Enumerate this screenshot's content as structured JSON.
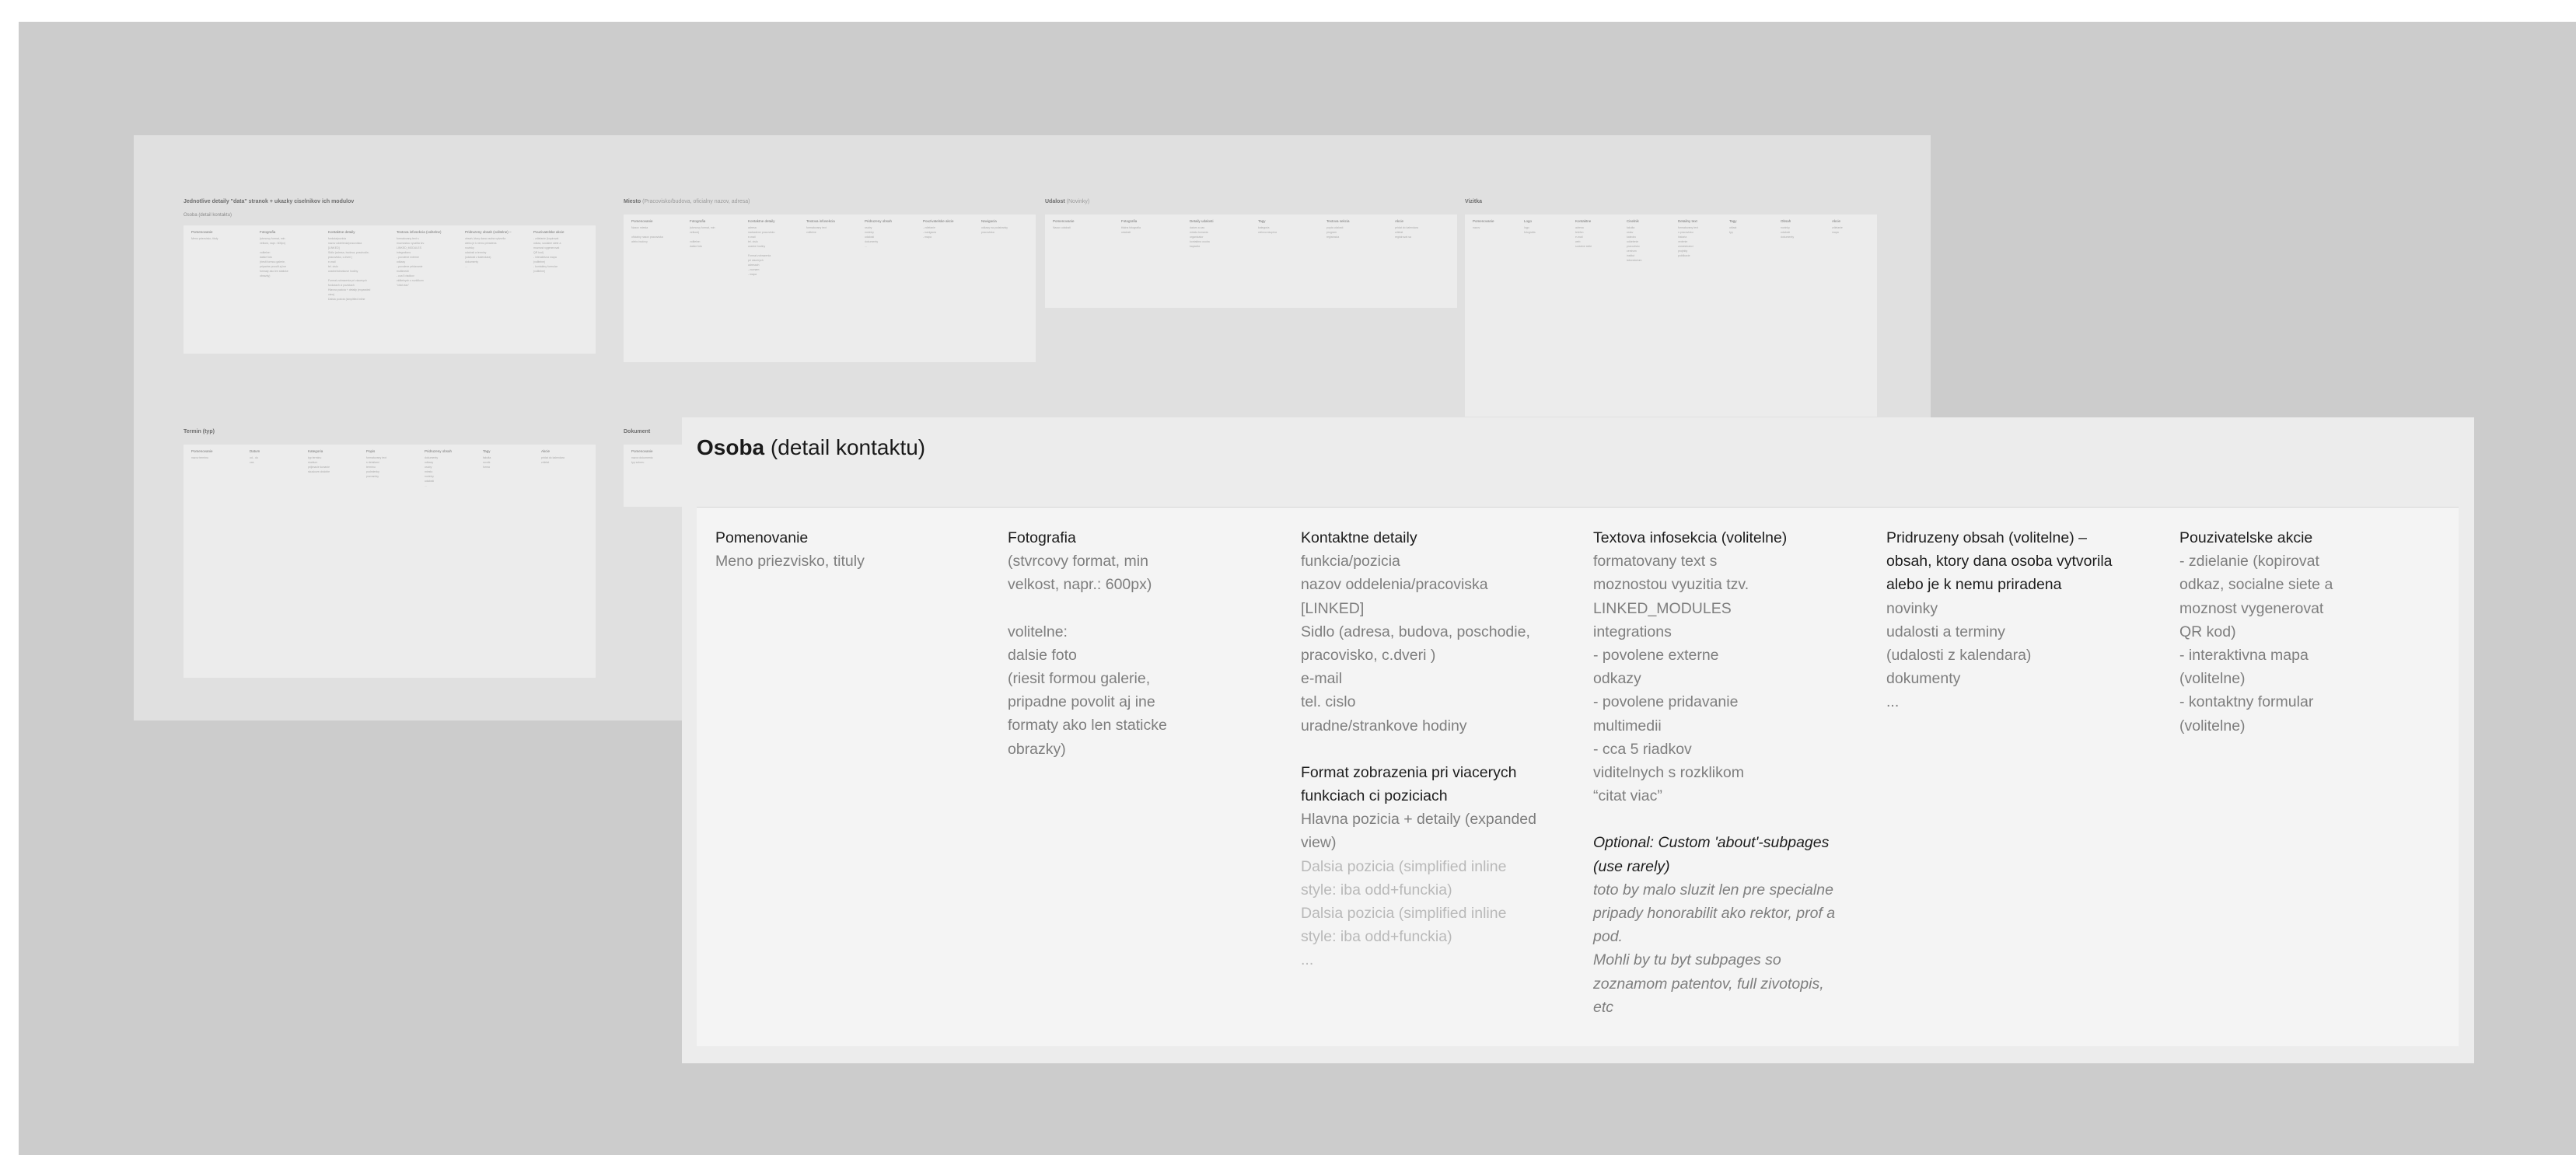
{
  "background_board": {
    "sections": [
      {
        "id": "detaily",
        "title": "Jednotlive detaily \"data\" stranok + ukazky ciselnikov ich modulov",
        "title_rest": "",
        "subtitle": "Osoba (detail kontaktu)",
        "columns": [
          {
            "head": "Pomenovanie",
            "lines": [
              "Meno priezvisko, tituly"
            ]
          },
          {
            "head": "Fotografia",
            "lines": [
              "(stvrcovy format, min",
              "velkost, napr.: 600px)",
              "",
              "volitelne:",
              "dalsie foto",
              "(riesit formou galerie,",
              "pripadne povolit aj ine",
              "formaty ako len staticke",
              "obrazky)"
            ]
          },
          {
            "head": "Kontaktne detaily",
            "lines": [
              "funkcia/pozicia",
              "nazov oddelenia/pracoviska",
              "[LINKED]",
              "Sidlo (adresa, budova, poschodie,",
              "pracovisko, c.dveri )",
              "e-mail",
              "tel. cislo",
              "uradne/strankove hodiny",
              "",
              "Format zobrazenia pri viacerych",
              "funkciach ci poziciach",
              "Hlavna pozicia + detaily (expanded",
              "view)",
              "Dalsia pozicia (simplified inline"
            ]
          },
          {
            "head": "Textova infosekcia (volitelne)",
            "lines": [
              "formatovany text s",
              "moznostou vyuzitia tzv.",
              "LINKED_MODULES",
              "integrations",
              "- povolene externe",
              "odkazy",
              "- povolene pridavanie",
              "multimedii",
              "- cca 5 riadkov",
              "viditelnych s rozklikom",
              "\"citat viac\""
            ]
          },
          {
            "head": "Pridruzeny obsah (volitelne) –",
            "lines": [
              "obsah, ktory dana osoba vytvorila",
              "alebo je k nemu priradena",
              "novinky",
              "udalosti a terminy",
              "(udalosti z kalendara)",
              "dokumenty",
              "..."
            ]
          },
          {
            "head": "Pouzivatelske akcie",
            "lines": [
              "- zdielanie (kopirovat",
              "odkaz, socialne siete a",
              "moznost vygenerovat",
              "QR kod)",
              "- interaktivna mapa",
              "(volitelne)",
              "- kontaktny formular",
              "(volitelne)"
            ]
          }
        ]
      },
      {
        "id": "miesto",
        "title": "Miesto",
        "title_rest": "(Pracovisko/budova, oficialny nazov, adresa)",
        "subtitle": "",
        "columns": [
          {
            "head": "Pomenovanie",
            "lines": [
              "Nazov miesta",
              "",
              "oficialny nazov pracoviska",
              "alebo budovy"
            ]
          },
          {
            "head": "Fotografia",
            "lines": [
              "(stvrcovy format, min",
              "velkost)",
              "",
              "volitelne:",
              "dalsie foto"
            ]
          },
          {
            "head": "Kontaktne detaily",
            "lines": [
              "adresa",
              "nadradene pracovisko",
              "e-mail",
              "tel. cislo",
              "uradne hodiny",
              "",
              "Format zobrazenia",
              "pri viacerych",
              "adresach",
              "- zoznam",
              "- mapa"
            ]
          },
          {
            "head": "Textova infosekcia",
            "lines": [
              "formatovany text",
              "volitelne"
            ]
          },
          {
            "head": "Pridruzeny obsah",
            "lines": [
              "osoby",
              "novinky",
              "udalosti",
              "dokumenty",
              "..."
            ]
          },
          {
            "head": "Pouzivatelske akcie",
            "lines": [
              "- zdielanie",
              "- navigacia",
              "- mapa"
            ]
          },
          {
            "head": "Navigacia",
            "lines": [
              "odkazy na podstranky",
              "pracoviska"
            ]
          }
        ]
      },
      {
        "id": "udalost",
        "title": "Udalost",
        "title_rest": "(Novinky)",
        "subtitle": "",
        "columns": [
          {
            "head": "Pomenovanie",
            "lines": [
              "Nazov udalosti"
            ]
          },
          {
            "head": "Fotografia",
            "lines": [
              "titulna fotografia",
              "udalosti"
            ]
          },
          {
            "head": "Detaily udalosti",
            "lines": [
              "datum a cas",
              "miesto konania",
              "organizator",
              "kontaktna osoba",
              "kapacita"
            ]
          },
          {
            "head": "Tagy",
            "lines": [
              "kategoria",
              "cielova skupina"
            ]
          },
          {
            "head": "Textova sekcia",
            "lines": [
              "popis udalosti",
              "program",
              "registracia"
            ]
          },
          {
            "head": "Akcie",
            "lines": [
              "pridat do kalendara",
              "zdielat",
              "registrovat sa"
            ]
          }
        ]
      },
      {
        "id": "vizitka",
        "title": "Vizitka",
        "title_rest": "",
        "subtitle": "",
        "columns": [
          {
            "head": "Pomenovanie",
            "lines": [
              "nazov"
            ]
          },
          {
            "head": "Logo",
            "lines": [
              "logo",
              "fotografia"
            ]
          },
          {
            "head": "Kontaktne",
            "lines": [
              "adresa",
              "telefon",
              "e-mail",
              "web",
              "socialne siete"
            ]
          },
          {
            "head": "Ciselnik",
            "lines": [
              "fakulta",
              "ustav",
              "katedra",
              "oddelenie",
              "pracovisko",
              "centrum",
              "institut",
              "laboratorium"
            ]
          },
          {
            "head": "Detailny text",
            "lines": [
              "formatovany text",
              "o pracovisku",
              "historia",
              "vedenie",
              "zamestnanci",
              "projekty",
              "publikacie"
            ]
          },
          {
            "head": "Tagy",
            "lines": [
              "oblast",
              "typ"
            ]
          },
          {
            "head": "Obsah",
            "lines": [
              "novinky",
              "udalosti",
              "dokumenty"
            ]
          },
          {
            "head": "Akcie",
            "lines": [
              "zdielanie",
              "mapa"
            ]
          }
        ]
      },
      {
        "id": "termin",
        "title": "Termin (typ)",
        "title_rest": "",
        "subtitle": "",
        "columns": [
          {
            "head": "Pomenovanie",
            "lines": [
              "nazov terminu"
            ]
          },
          {
            "head": "Datum",
            "lines": [
              "od - do",
              "cas"
            ]
          },
          {
            "head": "Kategoria",
            "lines": [
              "typ terminu",
              "studium",
              "prijimacie konanie",
              "skuskove obdobie"
            ]
          },
          {
            "head": "Popis",
            "lines": [
              "formatovany text",
              "s detailami",
              "terminu",
              "podmienky",
              "poznamky"
            ]
          },
          {
            "head": "Pridruzeny obsah",
            "lines": [
              "dokumenty",
              "odkazy",
              "osoby",
              "miesto",
              "novinky",
              "udalosti",
              "..."
            ]
          },
          {
            "head": "Tagy",
            "lines": [
              "fakulta",
              "rocnik",
              "forma"
            ]
          },
          {
            "head": "Akcie",
            "lines": [
              "pridat do kalendara",
              "zdielat"
            ]
          }
        ]
      },
      {
        "id": "dokument",
        "title": "Dokument",
        "title_rest": "",
        "subtitle": "",
        "columns": [
          {
            "head": "Pomenovanie",
            "lines": [
              "nazov dokumentu",
              "typ suboru"
            ]
          }
        ]
      }
    ]
  },
  "detail": {
    "title_bold": "Osoba",
    "title_rest": "(detail kontaktu)",
    "columns": [
      {
        "id": "pomenovanie",
        "header": [
          "Pomenovanie"
        ],
        "items": [
          {
            "style": "cl",
            "text": "Meno  priezvisko,  tituly"
          }
        ]
      },
      {
        "id": "fotografia",
        "header": [
          "Fotografia"
        ],
        "items": [
          {
            "style": "cl",
            "text": "(stvrcovy format, min"
          },
          {
            "style": "cl",
            "text": "velkost, napr.: 600px)"
          },
          {
            "style": "gap",
            "text": ""
          },
          {
            "style": "cl",
            "text": "volitelne:"
          },
          {
            "style": "cl",
            "text": "dalsie foto"
          },
          {
            "style": "cl",
            "text": "(riesit formou galerie,"
          },
          {
            "style": "cl",
            "text": "pripadne povolit aj ine"
          },
          {
            "style": "cl",
            "text": "formaty ako len staticke"
          },
          {
            "style": "cl",
            "text": "obrazky)"
          }
        ]
      },
      {
        "id": "kontaktne-detaily",
        "header": [
          "Kontaktne detaily"
        ],
        "items": [
          {
            "style": "cl",
            "text": "funkcia/pozicia"
          },
          {
            "style": "cl",
            "text": "nazov oddelenia/pracoviska"
          },
          {
            "style": "cl",
            "text": "[LINKED]"
          },
          {
            "style": "cl",
            "text": "Sidlo (adresa, budova, poschodie,"
          },
          {
            "style": "cl",
            "text": "pracovisko, c.dveri )"
          },
          {
            "style": "cl",
            "text": "e-mail"
          },
          {
            "style": "cl",
            "text": "tel. cislo"
          },
          {
            "style": "cl",
            "text": "uradne/strankove hodiny"
          },
          {
            "style": "gap",
            "text": ""
          },
          {
            "style": "ch",
            "text": "Format zobrazenia pri viacerych"
          },
          {
            "style": "ch",
            "text": "funkciach ci poziciach"
          },
          {
            "style": "cl",
            "text": "Hlavna pozicia + detaily (expanded"
          },
          {
            "style": "cl",
            "text": "view)"
          },
          {
            "style": "cf",
            "text": "Dalsia pozicia (simplified inline"
          },
          {
            "style": "cf",
            "text": "style: iba odd+funckia)"
          },
          {
            "style": "cf",
            "text": "Dalsia pozicia (simplified inline"
          },
          {
            "style": "cf",
            "text": "style: iba odd+funckia)"
          },
          {
            "style": "cf",
            "text": "..."
          }
        ]
      },
      {
        "id": "textova-infosekcia",
        "header": [
          "Textova infosekcia (volitelne)"
        ],
        "items": [
          {
            "style": "cl",
            "text": "formatovany text s"
          },
          {
            "style": "cl",
            "text": "moznostou vyuzitia tzv."
          },
          {
            "style": "cl",
            "text": "LINKED_MODULES"
          },
          {
            "style": "cl",
            "text": "integrations"
          },
          {
            "style": "cl",
            "text": "- povolene externe"
          },
          {
            "style": "cl",
            "text": "odkazy"
          },
          {
            "style": "cl",
            "text": "- povolene pridavanie"
          },
          {
            "style": "cl",
            "text": "multimedii"
          },
          {
            "style": "cl",
            "text": "- cca 5 riadkov"
          },
          {
            "style": "cl",
            "text": "viditelnych s rozklikom"
          },
          {
            "style": "cl",
            "text": "“citat viac”"
          },
          {
            "style": "gap",
            "text": ""
          },
          {
            "style": "cih",
            "text": "Optional: Custom 'about'-subpages"
          },
          {
            "style": "cih",
            "text": "(use rarely)"
          },
          {
            "style": "ci",
            "text": "toto by malo sluzit len pre specialne"
          },
          {
            "style": "ci",
            "text": "pripady honorabilit ako rektor, prof a"
          },
          {
            "style": "ci",
            "text": "pod."
          },
          {
            "style": "ci",
            "text": "Mohli by tu byt subpages so"
          },
          {
            "style": "ci",
            "text": "zoznamom patentov, full zivotopis,"
          },
          {
            "style": "ci",
            "text": "etc"
          }
        ]
      },
      {
        "id": "pridruzeny-obsah",
        "header": [
          "Pridruzeny obsah (volitelne) –",
          "obsah, ktory dana osoba vytvorila",
          "alebo je k nemu priradena"
        ],
        "items": [
          {
            "style": "cl",
            "text": "novinky"
          },
          {
            "style": "cl",
            "text": "udalosti a terminy"
          },
          {
            "style": "cl",
            "text": "(udalosti z kalendara)"
          },
          {
            "style": "cl",
            "text": "dokumenty"
          },
          {
            "style": "cl",
            "text": "..."
          }
        ]
      },
      {
        "id": "pouzivatelske-akcie",
        "header": [
          "Pouzivatelske akcie"
        ],
        "items": [
          {
            "style": "cl",
            "text": "- zdielanie (kopirovat"
          },
          {
            "style": "cl",
            "text": "odkaz, socialne siete a"
          },
          {
            "style": "cl",
            "text": "moznost vygenerovat"
          },
          {
            "style": "cl",
            "text": "QR kod)"
          },
          {
            "style": "cl",
            "text": "- interaktivna mapa"
          },
          {
            "style": "cl",
            "text": "(volitelne)"
          },
          {
            "style": "cl",
            "text": "- kontaktny formular"
          },
          {
            "style": "cl",
            "text": "(volitelne)"
          }
        ]
      }
    ]
  }
}
